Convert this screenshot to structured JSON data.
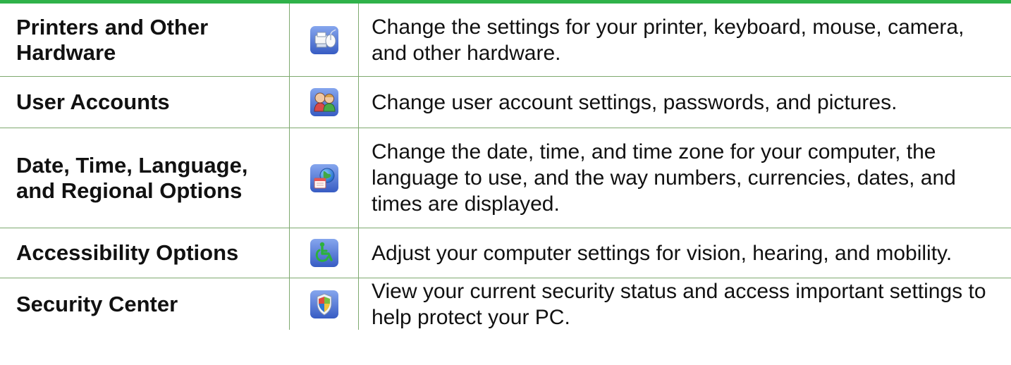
{
  "items": [
    {
      "title": "Printers and Other Hardware",
      "description": "Change the settings for your printer, keyboard, mouse, camera, and other hardware.",
      "icon": "printer-mouse-icon"
    },
    {
      "title": "User Accounts",
      "description": "Change user account settings, passwords, and pictures.",
      "icon": "users-icon"
    },
    {
      "title": "Date, Time, Language, and Regional Options",
      "description": "Change the date, time, and time zone for your computer, the language to use, and the way numbers, currencies, dates, and times are displayed.",
      "icon": "calendar-globe-icon"
    },
    {
      "title": "Accessibility Options",
      "description": "Adjust your computer settings for vision, hearing, and mobility.",
      "icon": "accessibility-icon"
    },
    {
      "title": "Security Center",
      "description": "View your current security status and access important settings to help protect your PC.",
      "icon": "shield-icon"
    }
  ],
  "colors": {
    "accent_bar": "#2fb24a",
    "grid_line": "#7ea96f",
    "text": "#111111",
    "icon_tile": "#4d72c7"
  }
}
